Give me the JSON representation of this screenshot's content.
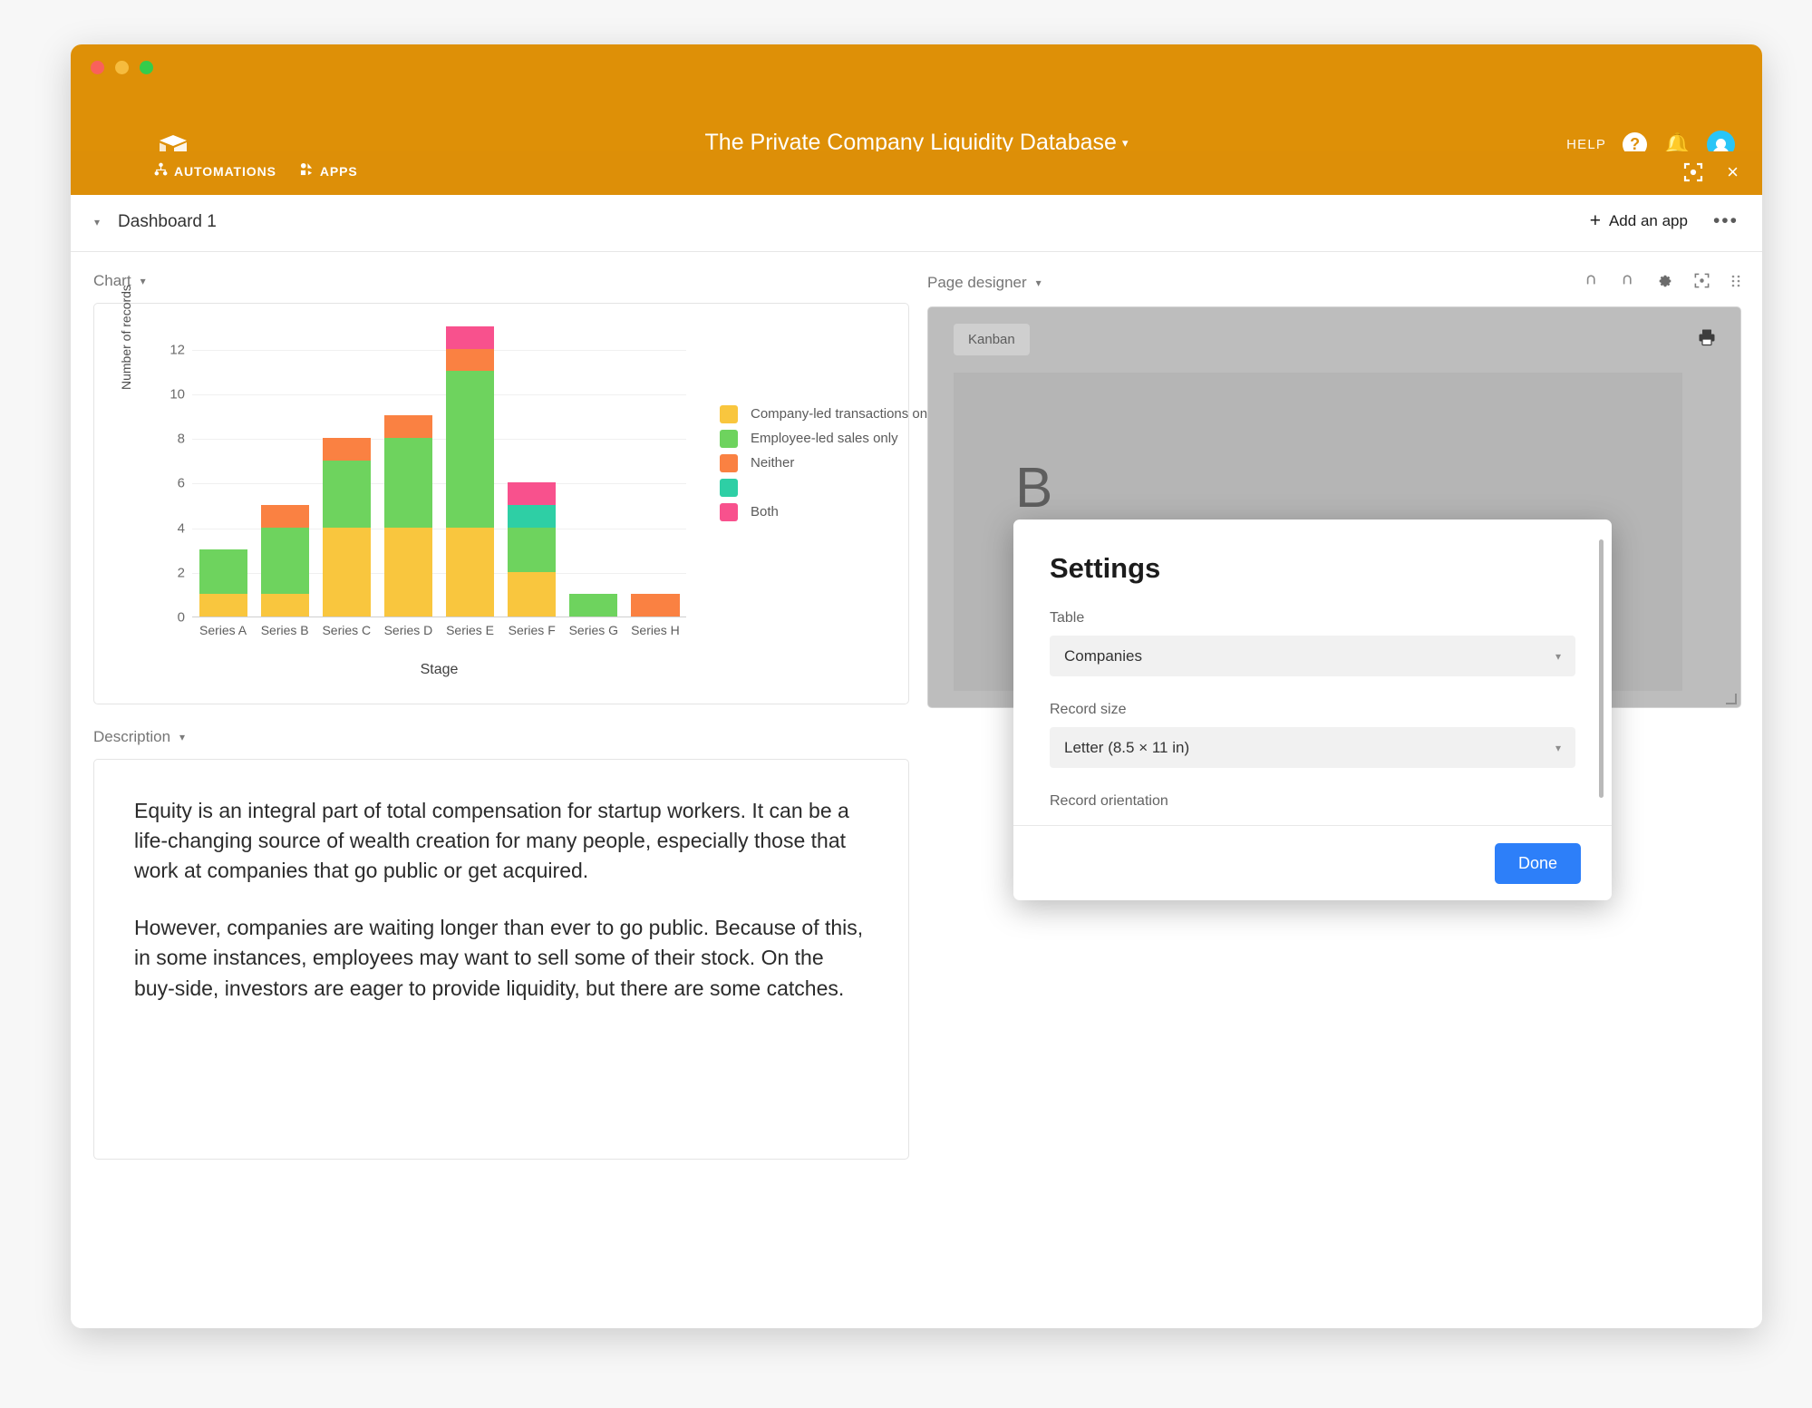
{
  "window": {
    "traffic_lights": [
      "close",
      "minimize",
      "zoom"
    ],
    "app_title": "The Private Company Liquidity Database",
    "title_caret": "▾",
    "logo_icon": "airtable-cube-icon",
    "header_right": {
      "help_label": "HELP",
      "help_icon": "question-circle-icon",
      "notifications_icon": "bell-icon",
      "avatar_icon": "user-avatar-icon"
    },
    "nav": [
      {
        "label": "AUTOMATIONS",
        "icon": "automations-icon"
      },
      {
        "label": "APPS",
        "icon": "apps-icon"
      }
    ],
    "strip_right": {
      "expand_icon": "expand-icon",
      "close_label": "×"
    }
  },
  "dashboard": {
    "caret": "▾",
    "name": "Dashboard 1",
    "add_app_label": "Add an app",
    "add_app_plus": "+",
    "overflow_label": "•••"
  },
  "chart_panel": {
    "label": "Chart",
    "caret": "▾"
  },
  "chart_data": {
    "type": "bar",
    "stacked": true,
    "title": "",
    "xlabel": "Stage",
    "ylabel": "Number of records",
    "categories": [
      "Series A",
      "Series B",
      "Series C",
      "Series D",
      "Series E",
      "Series F",
      "Series G",
      "Series H"
    ],
    "ylim": [
      0,
      13
    ],
    "yticks": [
      0,
      2,
      4,
      6,
      8,
      10,
      12
    ],
    "grid": true,
    "legend_position": "right",
    "series": [
      {
        "name": "Company-led transactions only",
        "color": "#f9c63e",
        "values": [
          1,
          1,
          4,
          4,
          4,
          2,
          0,
          0
        ]
      },
      {
        "name": "Employee-led sales only",
        "color": "#6ed35e",
        "values": [
          2,
          3,
          3,
          4,
          7,
          2,
          1,
          0
        ]
      },
      {
        "name": "Neither",
        "color": "#fa8142",
        "values": [
          0,
          1,
          1,
          1,
          1,
          0,
          0,
          1
        ]
      },
      {
        "name": "",
        "color": "#2ecfa5",
        "values": [
          0,
          0,
          0,
          0,
          0,
          1,
          0,
          0
        ]
      },
      {
        "name": "Both",
        "color": "#f8518d",
        "values": [
          0,
          0,
          0,
          0,
          1,
          1,
          0,
          0
        ]
      }
    ],
    "totals": [
      3,
      5,
      8,
      9,
      13,
      6,
      1,
      1
    ]
  },
  "page_designer": {
    "label": "Page designer",
    "caret": "▾",
    "icons": {
      "undo": "undo-icon",
      "redo": "redo-icon",
      "settings": "gear-icon",
      "expand": "expand-icon",
      "drag": "drag-handle-icon"
    },
    "kanban_label": "Kanban",
    "preview_letter": "B",
    "print_icon": "printer-icon"
  },
  "settings_modal": {
    "title": "Settings",
    "table_label": "Table",
    "table_value": "Companies",
    "record_size_label": "Record size",
    "record_size_value": "Letter (8.5 × 11 in)",
    "record_orientation_label": "Record orientation",
    "done_label": "Done",
    "accent_color": "#2d7ff9",
    "caret": "▾"
  },
  "description_panel": {
    "label": "Description",
    "caret": "▾",
    "paragraphs": [
      "Equity is an integral part of total compensation for startup workers. It can be a life-changing source of wealth creation for many people, especially those that work at companies that go public or get acquired.",
      "However, companies are waiting longer than ever to go public. Because of this, in some instances, employees may want to sell some of their stock. On the buy-side, investors are eager to provide liquidity, but there are some catches."
    ]
  },
  "colors": {
    "header_orange": "#de9007",
    "accent_blue": "#2d7ff9"
  }
}
